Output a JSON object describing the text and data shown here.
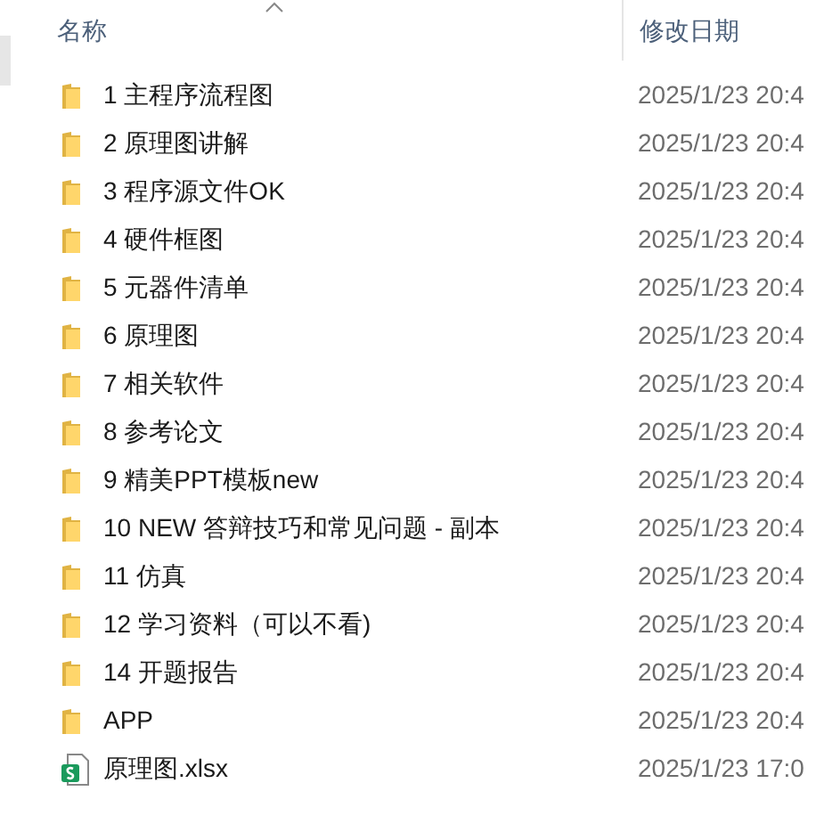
{
  "columns": [
    {
      "label": "名称",
      "sorted": true
    },
    {
      "label": "修改日期",
      "sorted": false
    }
  ],
  "files": [
    {
      "kind": "folder",
      "name": "1 主程序流程图",
      "modified": "2025/1/23 20:4"
    },
    {
      "kind": "folder",
      "name": "2 原理图讲解",
      "modified": "2025/1/23 20:4"
    },
    {
      "kind": "folder",
      "name": "3 程序源文件OK",
      "modified": "2025/1/23 20:4"
    },
    {
      "kind": "folder",
      "name": "4 硬件框图",
      "modified": "2025/1/23 20:4"
    },
    {
      "kind": "folder",
      "name": "5 元器件清单",
      "modified": "2025/1/23 20:4"
    },
    {
      "kind": "folder",
      "name": "6 原理图",
      "modified": "2025/1/23 20:4"
    },
    {
      "kind": "folder",
      "name": "7 相关软件",
      "modified": "2025/1/23 20:4"
    },
    {
      "kind": "folder",
      "name": "8 参考论文",
      "modified": "2025/1/23 20:4"
    },
    {
      "kind": "folder",
      "name": "9 精美PPT模板new",
      "modified": "2025/1/23 20:4"
    },
    {
      "kind": "folder",
      "name": "10 NEW 答辩技巧和常见问题 - 副本",
      "modified": "2025/1/23 20:4"
    },
    {
      "kind": "folder",
      "name": "11 仿真",
      "modified": "2025/1/23 20:4"
    },
    {
      "kind": "folder",
      "name": "12 学习资料（可以不看)",
      "modified": "2025/1/23 20:4"
    },
    {
      "kind": "folder",
      "name": "14 开题报告",
      "modified": "2025/1/23 20:4"
    },
    {
      "kind": "folder",
      "name": "APP",
      "modified": "2025/1/23 20:4"
    },
    {
      "kind": "spreadsheet",
      "name": "原理图.xlsx",
      "modified": "2025/1/23 17:0"
    }
  ]
}
